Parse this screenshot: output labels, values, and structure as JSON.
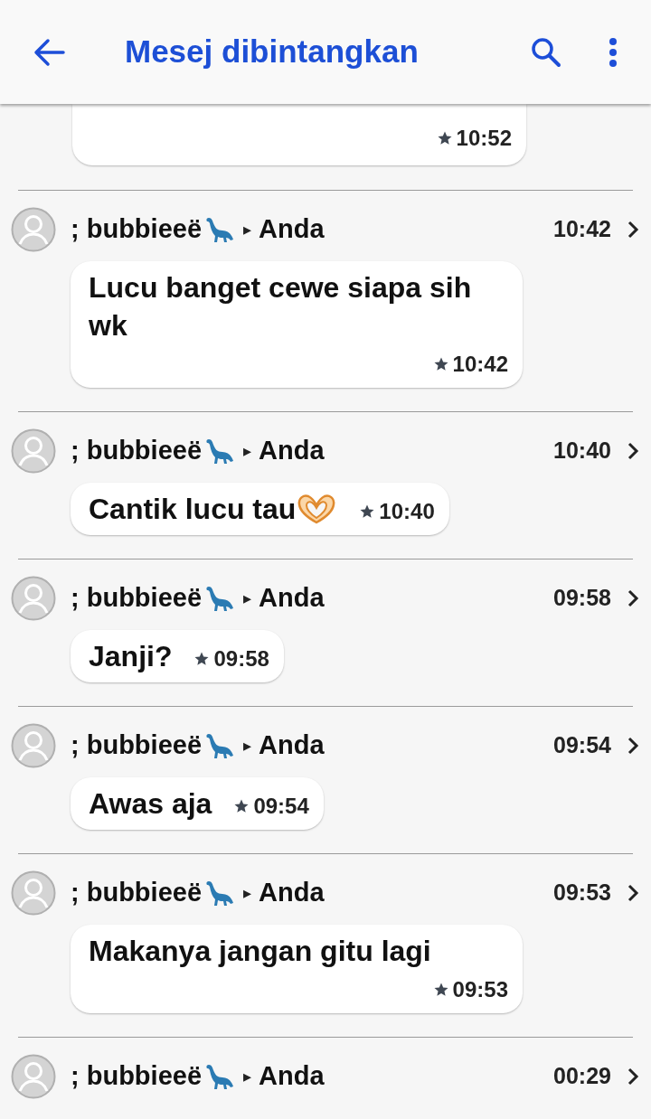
{
  "app_bar": {
    "title": "Mesej dibintangkan"
  },
  "messages": [
    {
      "kind": "clipped",
      "time": "10:52",
      "starred": true
    },
    {
      "kind": "message",
      "sender": "; bubbieeë",
      "arrow": "▸",
      "recipient": "Anda",
      "date": "10:42",
      "text": "Lucu banget cewe siapa sih wk",
      "time": "10:42",
      "starred": true,
      "trailing_icon": false
    },
    {
      "kind": "message",
      "sender": "; bubbieeë",
      "arrow": "▸",
      "recipient": "Anda",
      "date": "10:40",
      "text": "Cantik lucu tau",
      "time": "10:40",
      "starred": true,
      "trailing_icon": true
    },
    {
      "kind": "message",
      "sender": "; bubbieeë",
      "arrow": "▸",
      "recipient": "Anda",
      "date": "09:58",
      "text": "Janji?",
      "time": "09:58",
      "starred": true,
      "trailing_icon": false
    },
    {
      "kind": "message",
      "sender": "; bubbieeë",
      "arrow": "▸",
      "recipient": "Anda",
      "date": "09:54",
      "text": "Awas aja",
      "time": "09:54",
      "starred": true,
      "trailing_icon": false
    },
    {
      "kind": "message",
      "sender": "; bubbieeë",
      "arrow": "▸",
      "recipient": "Anda",
      "date": "09:53",
      "text": "Makanya jangan gitu lagi",
      "time": "09:53",
      "starred": true,
      "trailing_icon": false
    },
    {
      "kind": "message",
      "sender": "; bubbieeë",
      "arrow": "▸",
      "recipient": "Anda",
      "date": "00:29"
    }
  ]
}
